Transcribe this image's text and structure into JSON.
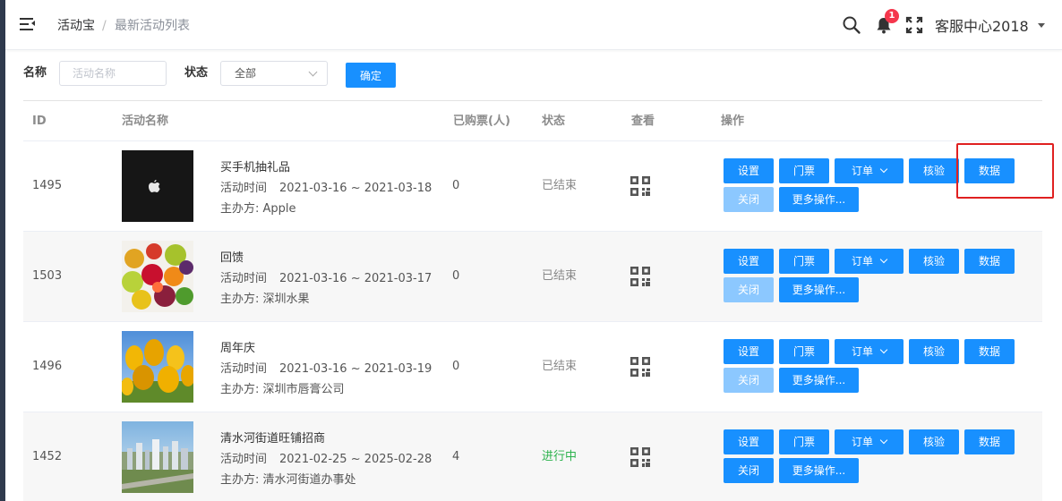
{
  "header": {
    "breadcrumb": [
      "活动宝",
      "最新活动列表"
    ],
    "breadcrumb_separator": "/",
    "notification_count": "1",
    "user_name": "客服中心2018"
  },
  "filters": {
    "name_label": "名称",
    "name_placeholder": "活动名称",
    "status_label": "状态",
    "status_selected": "全部",
    "confirm_label": "确定"
  },
  "table": {
    "columns": {
      "id": "ID",
      "name": "活动名称",
      "tickets": "已购票(人)",
      "status": "状态",
      "view": "查看",
      "actions": "操作"
    },
    "time_label": "活动时间",
    "rows": [
      {
        "id": "1495",
        "title": "买手机抽礼品",
        "time": "2021-03-16 ~ 2021-03-18",
        "organizer": "主办方: Apple",
        "tickets": "0",
        "status": "已结束",
        "status_kind": "ended",
        "thumb": "apple-logo",
        "close_enabled": false
      },
      {
        "id": "1503",
        "title": "回馈",
        "time": "2021-03-16 ~ 2021-03-17",
        "organizer": "主办方: 深圳水果",
        "tickets": "0",
        "status": "已结束",
        "status_kind": "ended",
        "thumb": "fruit-photo",
        "close_enabled": false
      },
      {
        "id": "1496",
        "title": "周年庆",
        "time": "2021-03-16 ~ 2021-03-19",
        "organizer": "主办方: 深圳市唇膏公司",
        "tickets": "0",
        "status": "已结束",
        "status_kind": "ended",
        "thumb": "tulip-photo",
        "close_enabled": false
      },
      {
        "id": "1452",
        "title": "清水河街道旺铺招商",
        "time": "2021-02-25 ~ 2025-02-28",
        "organizer": "主办方: 清水河街道办事处",
        "tickets": "4",
        "status": "进行中",
        "status_kind": "live",
        "thumb": "city-photo",
        "close_enabled": true
      }
    ],
    "actions": {
      "settings": "设置",
      "tickets": "门票",
      "orders": "订单",
      "verify": "核验",
      "data": "数据",
      "close": "关闭",
      "more": "更多操作..."
    }
  },
  "colors": {
    "primary": "#1890ff",
    "primary_disabled": "#8cc8ff",
    "status_live": "#2bb24c",
    "badge": "#f5364c",
    "highlight": "#e02020"
  }
}
